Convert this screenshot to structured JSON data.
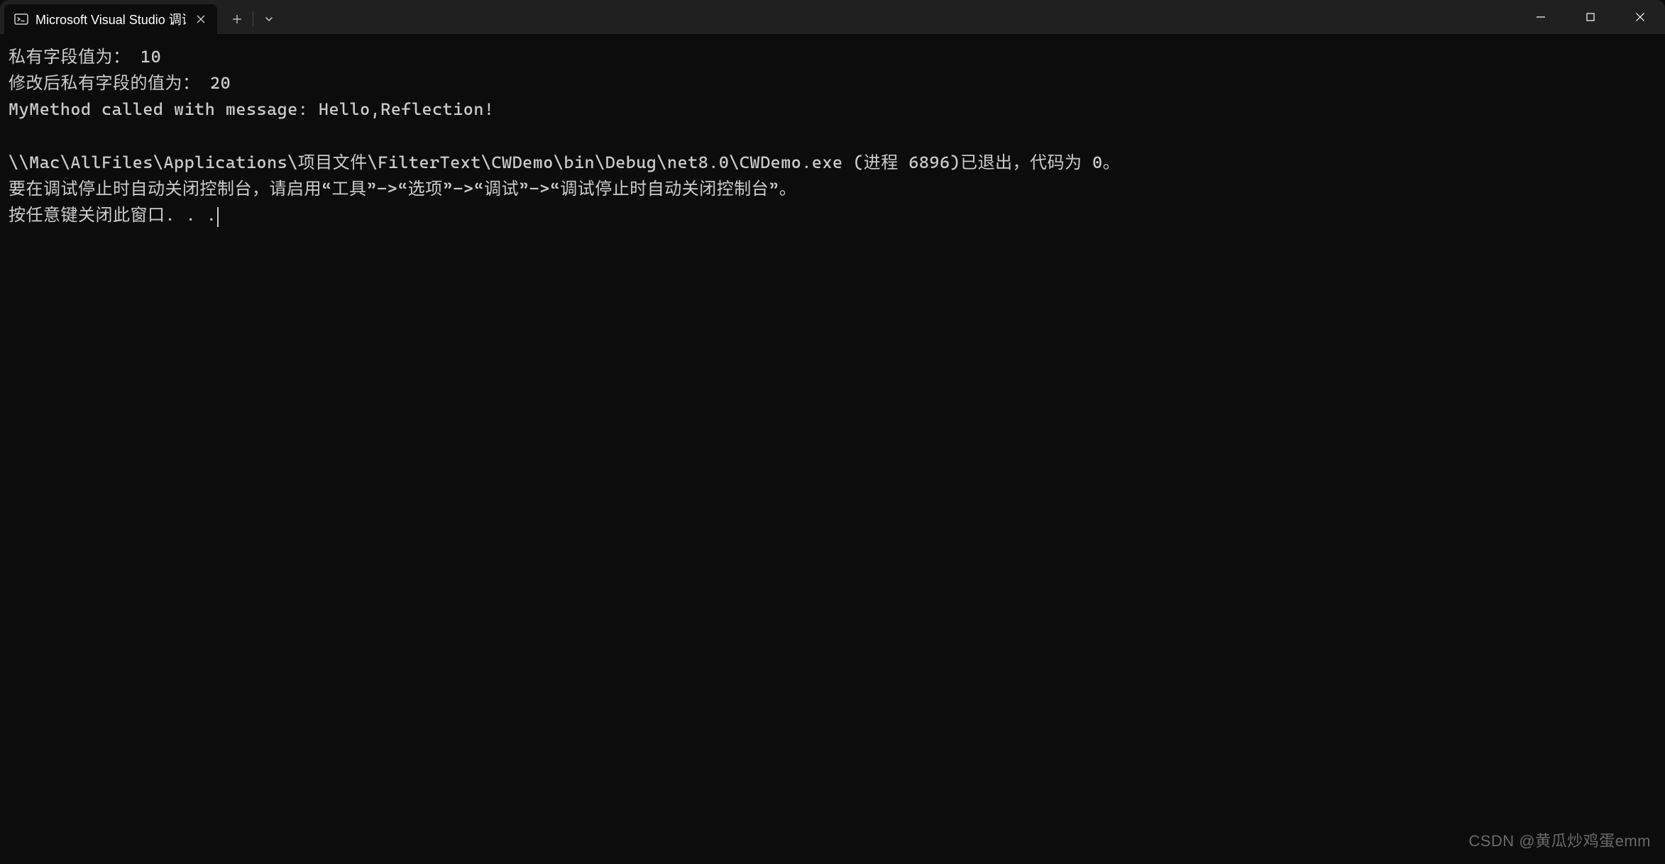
{
  "titlebar": {
    "tab_title": "Microsoft Visual Studio 调试控"
  },
  "console": {
    "line1": "私有字段值为： 10",
    "line2": "修改后私有字段的值为： 20",
    "line3": "MyMethod called with message: Hello,Reflection!",
    "line4": "",
    "line5": "\\\\Mac\\AllFiles\\Applications\\项目文件\\FilterText\\CWDemo\\bin\\Debug\\net8.0\\CWDemo.exe (进程 6896)已退出，代码为 0。",
    "line6": "要在调试停止时自动关闭控制台，请启用“工具”->“选项”->“调试”->“调试停止时自动关闭控制台”。",
    "line7": "按任意键关闭此窗口. . ."
  },
  "watermark": "CSDN @黄瓜炒鸡蛋emm"
}
